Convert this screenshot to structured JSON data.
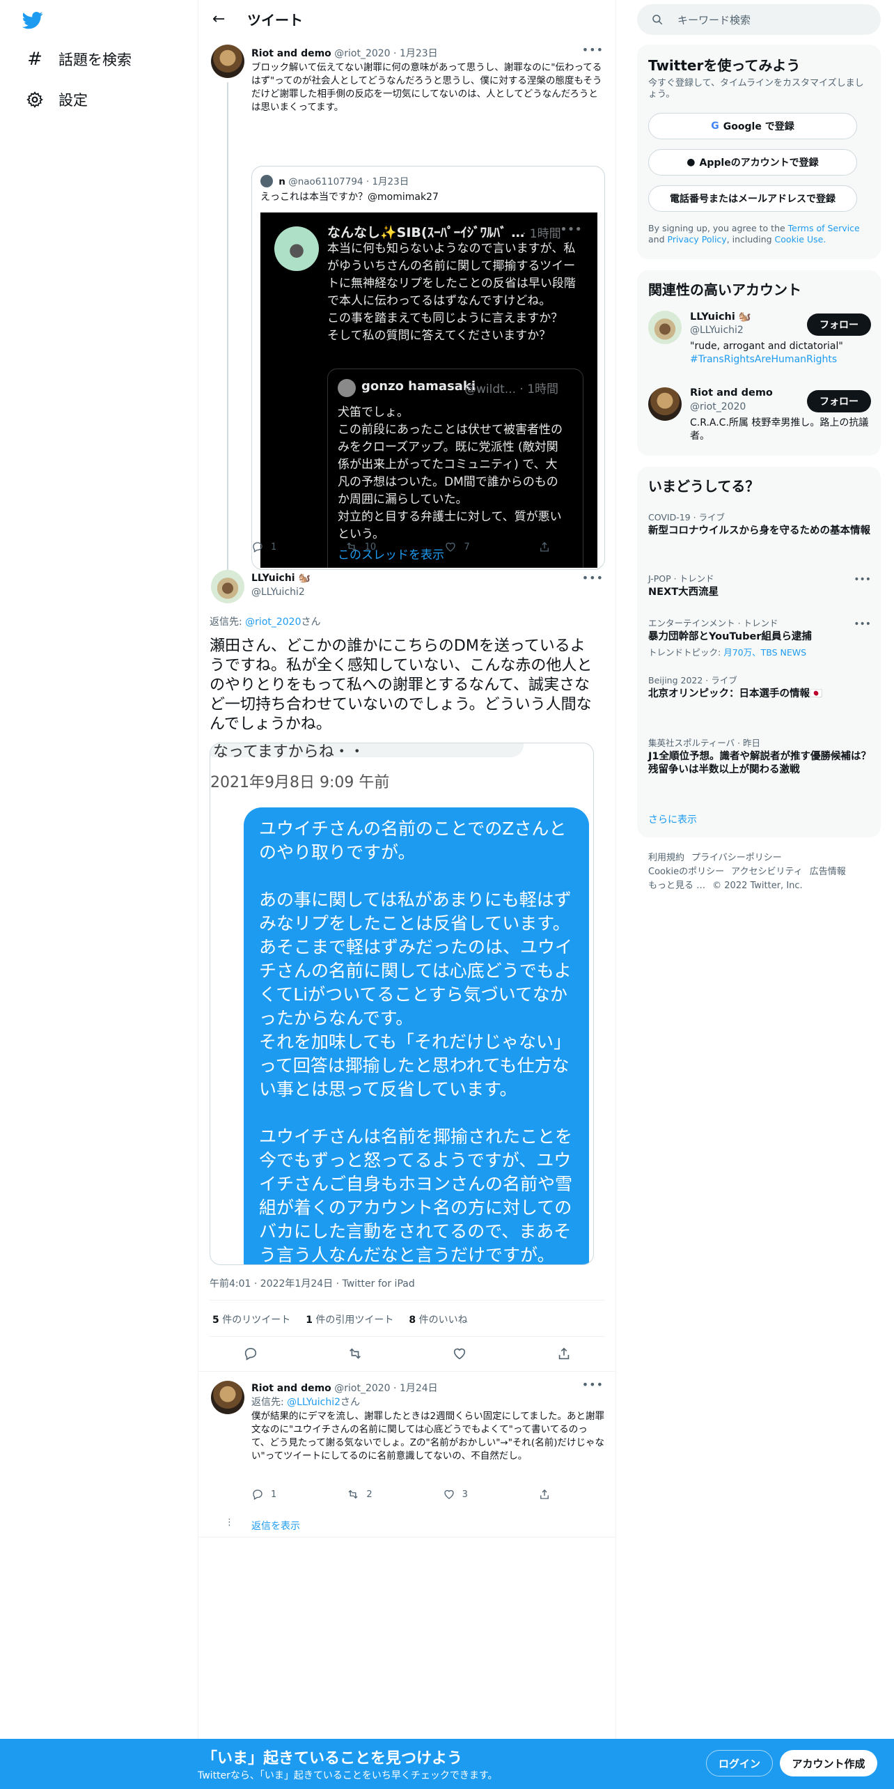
{
  "nav": {
    "explore": "話題を検索",
    "settings": "設定"
  },
  "header": {
    "title": "ツイート"
  },
  "tweet1": {
    "name": "Riot and demo",
    "handle": "@riot_2020",
    "date": "1月23日",
    "text": "ブロック解いて伝えてない謝罪に何の意味があって思うし、謝罪なのに\"伝わってるはず\"ってのが社会人としてどうなんだろうと思うし、僕に対する涅槃の態度もそうだけど謝罪した相手側の反応を一切気にしてないのは、人としてどうなんだろうとは思いまくってます。",
    "quote": {
      "name": "n",
      "handle": "@nao61107794",
      "date": "1月23日",
      "text": "えっこれは本当ですか？@momimak27",
      "shot": {
        "name": "なんなし✨SIB(ｽｰﾊﾟｰｲｼﾞﾜﾙﾊﾞ …",
        "time": "· 1時間",
        "body": "本当に何も知らないようなので言いますが、私がゆういちさんの名前に関して揶揄するツイートに無神経なリプをしたことの反省は早い段階で本人に伝わってるはずなんですけどね。\nこの事を踏まえても同じように言えますか？\nそして私の質問に答えてくださいますか？",
        "inner_name": "gonzo hamasaki",
        "inner_handle": "@wildt... · 1時間",
        "inner_body": "犬笛でしょ。\nこの前段にあったことは伏せて被害者性のみをクローズアップ。既に党派性 (敵対関係が出来上がってたコミュニティ) で、大凡の予想はついた。DM間で誰からのものか周囲に漏らしていた。\n対立的と目する弁護士に対して、質が悪いという。",
        "inner_link": "このスレッドを表示"
      }
    },
    "replies": "1",
    "retweets": "10",
    "likes": "7"
  },
  "tweet2": {
    "name": "LLYuichi 🐿️",
    "handle": "@LLYuichi2",
    "reply_to_prefix": "返信先: ",
    "reply_to": "@riot_2020",
    "reply_to_suffix": "さん",
    "text": "瀬田さん、どこかの誰かにこちらのDMを送っているようですね。私が全く感知していない、こんな赤の他人とのやりとりをもって私への謝罪とするなんて、誠実さなど一切持ち合わせていないのでしょう。どういう人間なんでしょうかね。",
    "dm": {
      "top": "なってますからね・・",
      "date": "2021年9月8日 9:09 午前",
      "bubble": "ユウイチさんの名前のことでのZさんとのやり取りですが。\n\nあの事に関しては私があまりにも軽はずみなリプをしたことは反省しています。あそこまで軽はずみだったのは、ユウイチさんの名前に関しては心底どうでもよくてLiがついてることすら気づいてなかったからなんです。\nそれを加味しても「それだけじゃない」って回答は揶揄したと思われても仕方ない事とは思って反省しています。\n\nユウイチさんは名前を揶揄されたことを今でもずっと怒ってるようですが、ユウイチさんご自身もホヨンさんの名前や雪組が着くのアカウント名の方に対してのバカにした言動をされてるので、まあそう言う人なんだなと言うだけですが。"
    },
    "meta": "午前4:01 · 2022年1月24日 · Twitter for iPad",
    "retweets_n": "5",
    "retweets_label": "件のリツイート",
    "quotes_n": "1",
    "quotes_label": "件の引用ツイート",
    "likes_n": "8",
    "likes_label": "件のいいね"
  },
  "tweet3": {
    "name": "Riot and demo",
    "handle": "@riot_2020",
    "date": "1月24日",
    "reply_to_prefix": "返信先: ",
    "reply_to": "@LLYuichi2",
    "reply_to_suffix": "さん",
    "text": "僕が結果的にデマを流し、謝罪したときは2週間くらい固定にしてました。あと謝罪文なのに\"ユウイチさんの名前に関しては心底どうでもよくて\"って書いてるのって、どう見たって謝る気ないでしょ。Zの\"名前がおかしい\"→\"それ(名前)だけじゃない\"ってツイートにしてるのに名前意識してないの、不自然だし。",
    "replies": "1",
    "retweets": "2",
    "likes": "3",
    "show_replies": "返信を表示"
  },
  "search": {
    "placeholder": "キーワード検索"
  },
  "signup_card": {
    "title": "Twitterを使ってみよう",
    "subtitle": "今すぐ登録して、タイムラインをカスタマイズしましょう。",
    "google": "Google で登録",
    "apple": "Appleのアカウントで登録",
    "phone": "電話番号またはメールアドレスで登録",
    "terms_pre": "By signing up, you agree to the ",
    "terms": "Terms of Service",
    "terms_and": " and ",
    "privacy": "Privacy Policy",
    "including": ", including ",
    "cookie": "Cookie Use."
  },
  "relevant": {
    "title": "関連性の高いアカウント",
    "accounts": [
      {
        "name": "LLYuichi 🐿️",
        "handle": "@LLYuichi2",
        "bio": "\"rude, arrogant and dictatorial\"",
        "bio_link": "#TransRightsAreHumanRights",
        "follow": "フォロー"
      },
      {
        "name": "Riot and demo",
        "handle": "@riot_2020",
        "bio": "C.R.A.C.所属 枝野幸男推し。路上の抗議者。",
        "follow": "フォロー"
      }
    ]
  },
  "trends": {
    "title": "いまどうしてる？",
    "items": [
      {
        "category": "COVID-19 · ライブ",
        "title": "新型コロナウイルスから身を守るための基本情報"
      },
      {
        "category": "J-POP · トレンド",
        "title": "NEXT大西流星"
      },
      {
        "category": "エンターテインメント · トレンド",
        "title": "暴力団幹部とYouTuber組員ら逮捕",
        "topic_prefix": "トレンドトピック: ",
        "topic": "月70万、TBS NEWS"
      },
      {
        "category": "Beijing 2022 · ライブ",
        "title": "北京オリンピック：日本選手の情報🇯🇵"
      },
      {
        "category": "集英社スポルティーバ · 昨日",
        "title": "J1全順位予想。識者や解説者が推す優勝候補は？　残留争いは半数以上が関わる激戦"
      }
    ],
    "more": "さらに表示"
  },
  "footer": {
    "line1": [
      "利用規約",
      "プライバシーポリシー"
    ],
    "line2": [
      "Cookieのポリシー",
      "アクセシビリティ",
      "広告情報"
    ],
    "line3": [
      "もっと見る …",
      "© 2022 Twitter, Inc."
    ]
  },
  "bottom_bar": {
    "title": "「いま」起きていることを見つけよう",
    "subtitle": "Twitterなら、「いま」起きていることをいち早くチェックできます。",
    "login": "ログイン",
    "signup": "アカウント作成"
  },
  "colors": {
    "accent": "#1d9bf0",
    "text": "#0f1419",
    "muted": "#536471"
  }
}
